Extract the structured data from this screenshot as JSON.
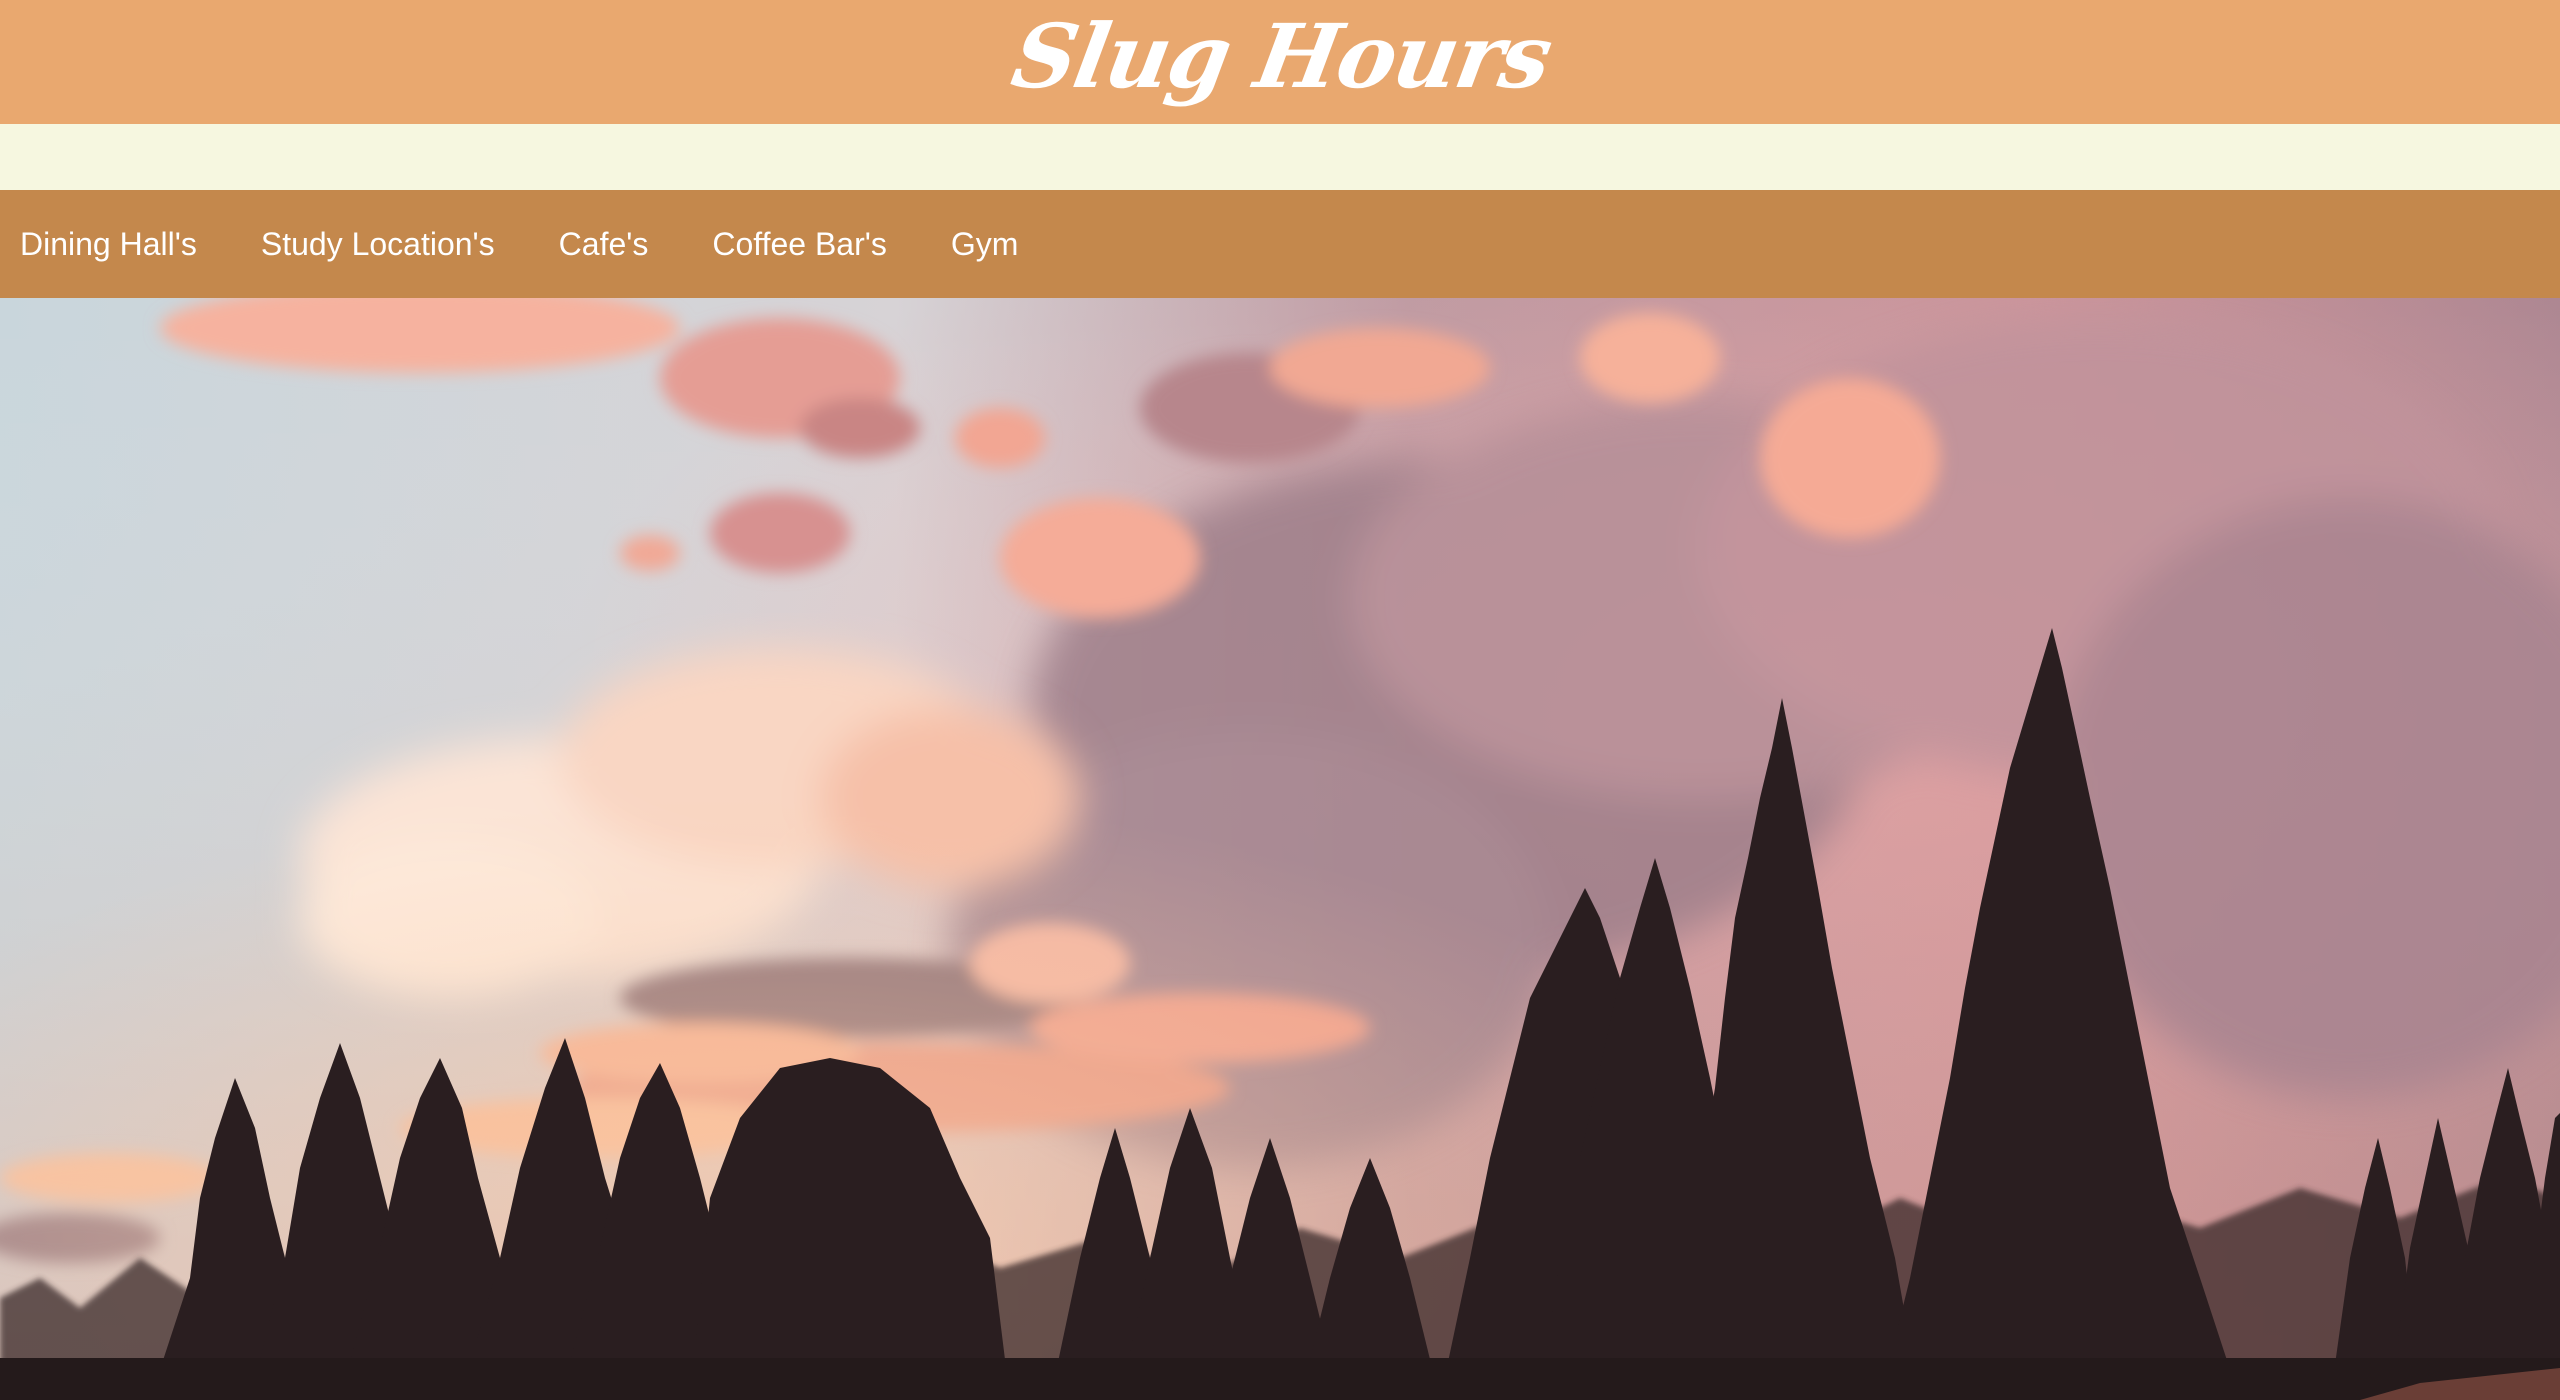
{
  "header": {
    "title": "Slug Hours"
  },
  "nav": {
    "items": [
      {
        "label": "Dining Hall's"
      },
      {
        "label": "Study Location's"
      },
      {
        "label": "Cafe's"
      },
      {
        "label": "Coffee Bar's"
      },
      {
        "label": "Gym"
      }
    ]
  },
  "colors": {
    "header_bg": "#e9a86f",
    "band_bg": "#f6f7e0",
    "nav_bg": "#c4884c",
    "nav_text": "#ffffff"
  },
  "hero": {
    "image": "sunset-redwood-forest-photo"
  }
}
